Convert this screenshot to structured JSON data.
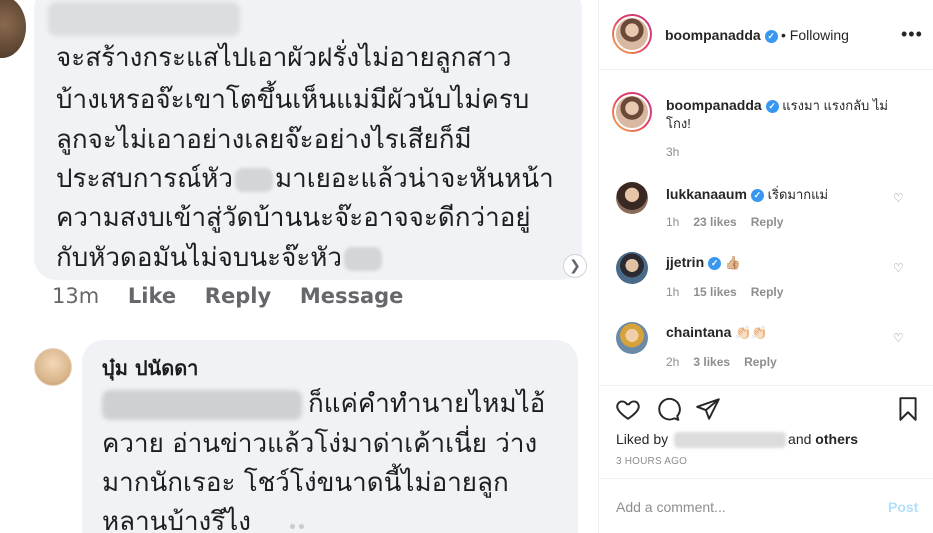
{
  "facebook": {
    "comment1": {
      "lines": [
        "จะสร้างกระแสไปเอาผัวฝรั่งไม่อายลูกสาว",
        "บ้างเหรอจ๊ะเขาโตขึ้นเห็นแม่มีผัวนับไม่ครบ",
        "ลูกจะไม่เอาอย่างเลยจ๊ะอย่างไรเสียก็มี",
        "ประสบการณ์หัว",
        "มาเยอะแล้วน่าจะหันหน้า",
        "ความสงบเข้าสู่วัดบ้านนะจ๊ะอาจจะดีกว่าอยู่",
        "กับหัวดอมันไม่จบนะจ๊ะหัว"
      ],
      "time": "13m",
      "like": "Like",
      "reply": "Reply",
      "message": "Message"
    },
    "comment2": {
      "name": "บุ๋ม ปนัดดา",
      "lines": [
        "ก็แค่คำทำนายไหมไอ้",
        "ควาย อ่านข่าวแล้วโง่มาด่าเค้าเนี่ย ว่าง",
        "มากนักเรอะ โชว์โง่ขนาดนี้ไม่อายลูก",
        "หลานบ้างรึไง"
      ]
    }
  },
  "instagram": {
    "header": {
      "username": "boompanadda",
      "separator": "•",
      "follow_label": "Following",
      "more_icon": "more-horizontal-icon"
    },
    "caption": {
      "username": "boompanadda",
      "text": "แรงมา แรงกลับ ไม่โกง!",
      "time": "3h"
    },
    "comments": [
      {
        "username": "lukkanaaum",
        "verified": true,
        "text": "เริ่ดมากแม่",
        "time": "1h",
        "likes": "23 likes",
        "reply": "Reply"
      },
      {
        "username": "jjetrin",
        "verified": true,
        "text": "👍🏼",
        "time": "1h",
        "likes": "15 likes",
        "reply": "Reply"
      },
      {
        "username": "chaintana",
        "verified": false,
        "text": "👏🏻👏🏻",
        "time": "2h",
        "likes": "3 likes",
        "reply": "Reply"
      }
    ],
    "actions": {
      "liked_by_prefix": "Liked by",
      "liked_by_suffix": "and",
      "others": "others",
      "time_ago": "3 HOURS AGO"
    },
    "add_comment": {
      "placeholder": "Add a comment...",
      "post_label": "Post"
    },
    "colors": {
      "verified": "#3897f0",
      "post_disabled": "#b2dffc",
      "secondary_text": "#8e8e8e"
    }
  }
}
